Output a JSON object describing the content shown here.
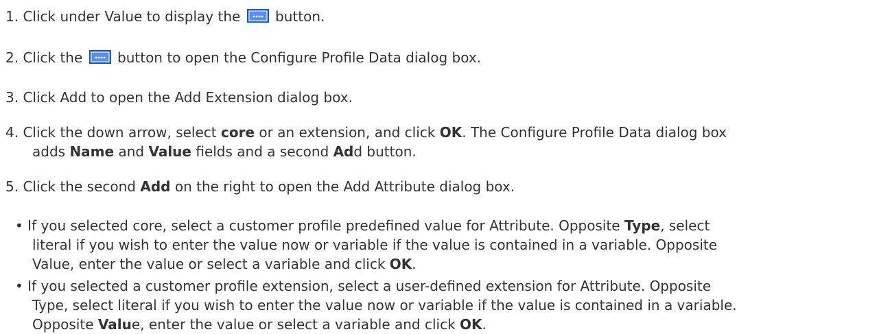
{
  "steps": [
    {
      "num": "1.",
      "a": "Click under Value to display the",
      "b": "button."
    },
    {
      "num": "2.",
      "a": "Click the",
      "b": "button to open the Configure Profile Data dialog box."
    },
    {
      "num": "3.",
      "a": "Click Add to open the Add Extension dialog box."
    },
    {
      "num": "4.",
      "a": "Click the down arrow, select",
      "b": "core",
      "c": "or an extension, and click",
      "d": "OK",
      "e": ". The Configure Profile Data dialog box",
      "f": "adds",
      "g": "Name",
      "h": "and",
      "i": "Value",
      "j": "fields and a second",
      "k": "Ad",
      "l": "d button."
    },
    {
      "num": "5.",
      "a": "Click the second",
      "b": "Add",
      "c": "on the right to open the Add Attribute dialog box."
    }
  ],
  "bullets": [
    {
      "marker": "•",
      "a": "If you selected core, select a customer profile predefined value for Attribute. Opposite",
      "b": "Type",
      "c": ", select",
      "d": "literal if you wish to enter the value now or variable if the value is contained in a variable. Opposite",
      "e": "Value, enter the value or select a variable and click",
      "f": "OK",
      "g": "."
    },
    {
      "marker": "•",
      "a": "If you selected a customer profile extension, select a user-defined extension for Attribute. Opposite",
      "b": "Type, select literal if you wish to enter the value now or variable if the value is contained in a variable.",
      "c": "Opposite",
      "d": "Valu",
      "e": "e, enter the value or select a variable and click",
      "f": "OK",
      "g": "."
    }
  ],
  "icons": {
    "ellipsis_button": "ellipsis-button-icon"
  },
  "colors": {
    "text": "#333333",
    "button_fill": "#2f6fd6",
    "button_dots": "#ffffff"
  }
}
